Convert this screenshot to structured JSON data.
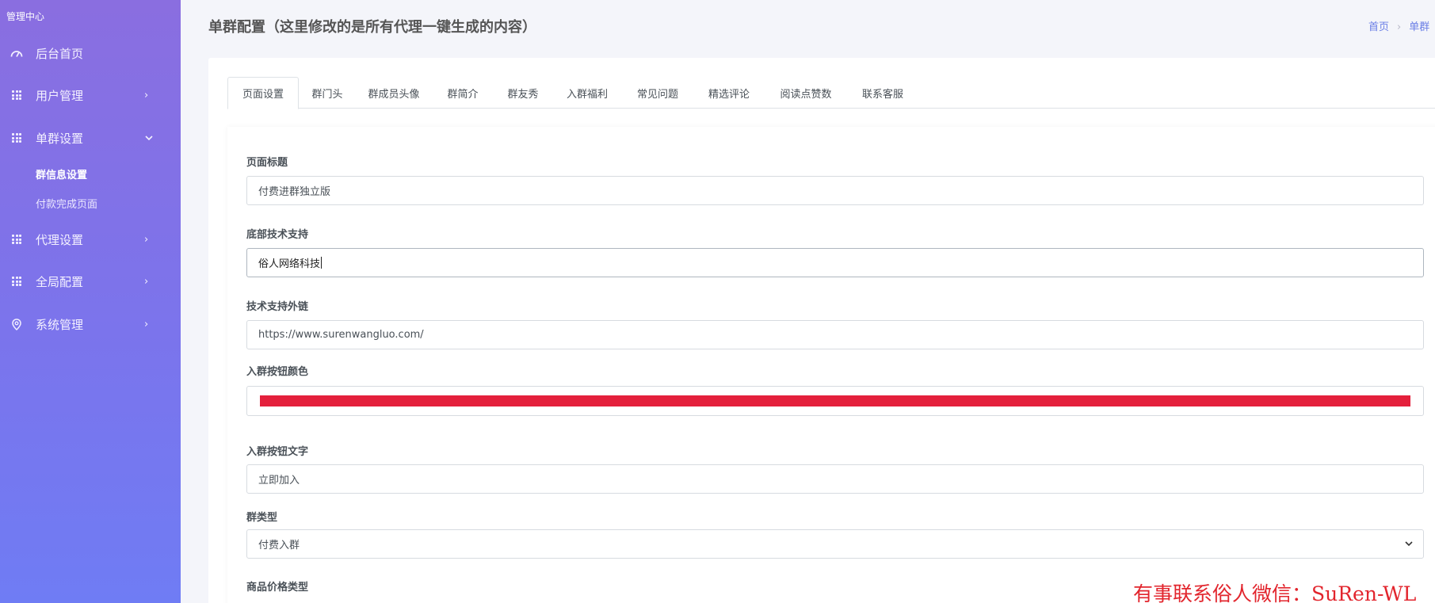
{
  "sidebar": {
    "brand": "管理中心",
    "items": [
      {
        "label": "后台首页",
        "icon": "gauge-icon"
      },
      {
        "label": "用户管理",
        "icon": "grid-icon",
        "chevron": "›"
      },
      {
        "label": "单群设置",
        "icon": "grid-icon",
        "chevron": "⌄"
      },
      {
        "label": "代理设置",
        "icon": "grid-icon",
        "chevron": "›"
      },
      {
        "label": "全局配置",
        "icon": "grid-icon",
        "chevron": "›"
      },
      {
        "label": "系统管理",
        "icon": "location-pin-icon",
        "chevron": "›"
      }
    ],
    "subitems": [
      {
        "label": "群信息设置",
        "active": true
      },
      {
        "label": "付款完成页面",
        "active": false
      }
    ]
  },
  "header": {
    "title": "单群配置（这里修改的是所有代理一键生成的内容）",
    "breadcrumb": [
      "首页",
      "单群"
    ],
    "breadcrumb_sep": "›"
  },
  "tabs": [
    "页面设置",
    "群门头",
    "群成员头像",
    "群简介",
    "群友秀",
    "入群福利",
    "常见问题",
    "精选评论",
    "阅读点赞数",
    "联系客服"
  ],
  "active_tab": "页面设置",
  "form": {
    "page_title": {
      "label": "页面标题",
      "value": "付费进群独立版"
    },
    "footer_support": {
      "label": "底部技术支持",
      "value": "俗人网络科技"
    },
    "support_link": {
      "label": "技术支持外链",
      "value": "https://www.surenwangluo.com/"
    },
    "button_color": {
      "label": "入群按钮颜色",
      "value": "#e4203c"
    },
    "button_text": {
      "label": "入群按钮文字",
      "value": "立即加入"
    },
    "group_type": {
      "label": "群类型",
      "value": "付费入群"
    },
    "price_type": {
      "label": "商品价格类型"
    }
  },
  "watermark": "有事联系俗人微信：SuRen-WL"
}
